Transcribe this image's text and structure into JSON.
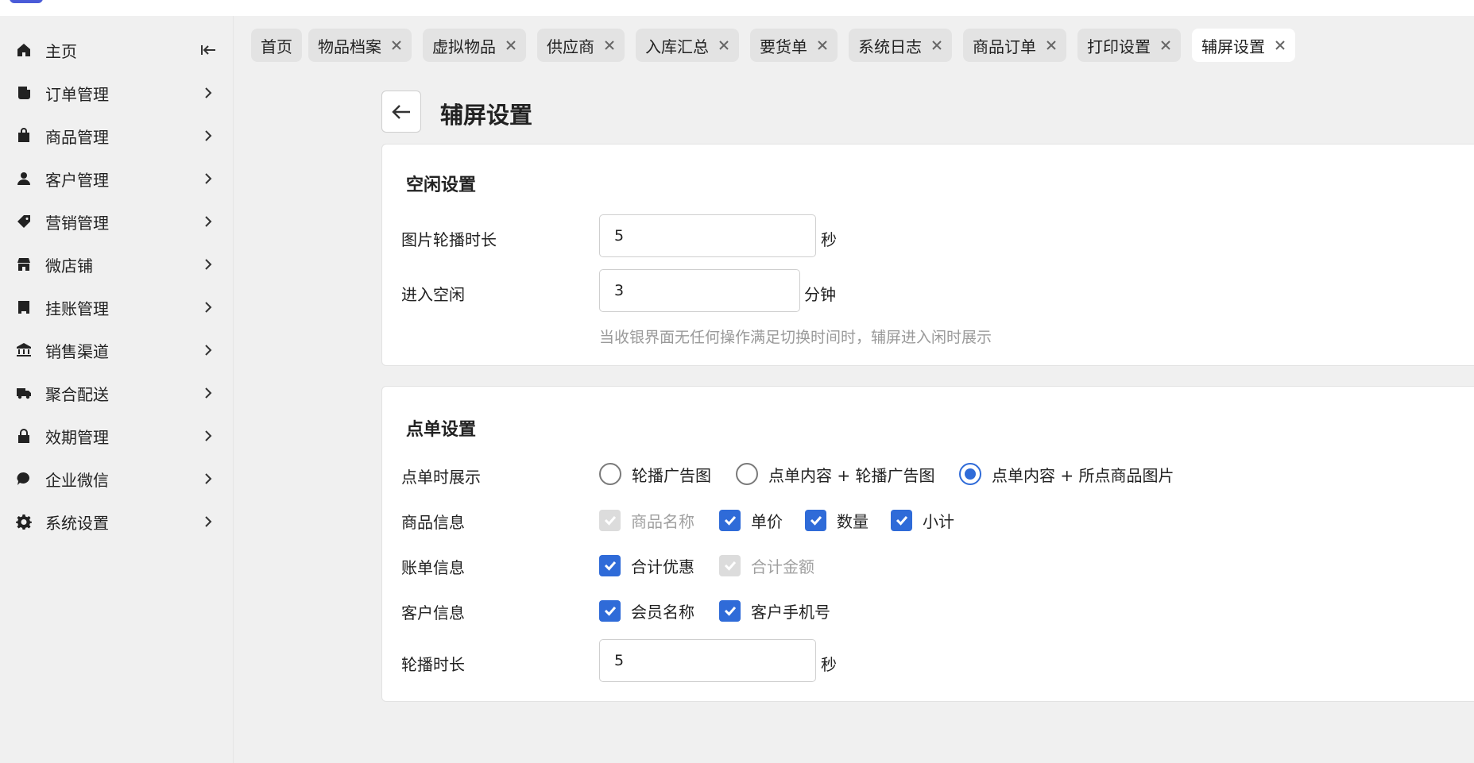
{
  "colors": {
    "accent": "#2f6bd8",
    "disabled": "#dcdcdc",
    "page_bg": "#f0f0f0"
  },
  "sidebar": {
    "items": [
      {
        "label": "主页",
        "icon": "home-icon"
      },
      {
        "label": "订单管理",
        "icon": "order-icon"
      },
      {
        "label": "商品管理",
        "icon": "product-icon"
      },
      {
        "label": "客户管理",
        "icon": "user-icon"
      },
      {
        "label": "营销管理",
        "icon": "tag-icon"
      },
      {
        "label": "微店铺",
        "icon": "shop-icon"
      },
      {
        "label": "挂账管理",
        "icon": "ledger-icon"
      },
      {
        "label": "销售渠道",
        "icon": "bank-icon"
      },
      {
        "label": "聚合配送",
        "icon": "truck-icon"
      },
      {
        "label": "效期管理",
        "icon": "lock-icon"
      },
      {
        "label": "企业微信",
        "icon": "chat-icon"
      },
      {
        "label": "系统设置",
        "icon": "gear-icon"
      }
    ]
  },
  "tabs": [
    {
      "label": "首页"
    },
    {
      "label": "物品档案"
    },
    {
      "label": "虚拟物品"
    },
    {
      "label": "供应商"
    },
    {
      "label": "入库汇总"
    },
    {
      "label": "要货单"
    },
    {
      "label": "系统日志"
    },
    {
      "label": "商品订单"
    },
    {
      "label": "打印设置"
    },
    {
      "label": "辅屏设置"
    }
  ],
  "page": {
    "title": "辅屏设置"
  },
  "idle": {
    "title": "空闲设置",
    "carousel": {
      "label": "图片轮播时长",
      "value": "5",
      "unit": "秒"
    },
    "enter_idle": {
      "label": "进入空闲",
      "value": "3",
      "unit": "分钟"
    },
    "hint": "当收银界面无任何操作满足切换时间时，辅屏进入闲时展示"
  },
  "order": {
    "title": "点单设置",
    "display": {
      "label": "点单时展示",
      "options": [
        {
          "label": "轮播广告图",
          "checked": false
        },
        {
          "label": "点单内容 + 轮播广告图",
          "checked": false
        },
        {
          "label": "点单内容 + 所点商品图片",
          "checked": true
        }
      ]
    },
    "goods_info": {
      "label": "商品信息",
      "options": [
        {
          "label": "商品名称",
          "checked": true,
          "disabled": true
        },
        {
          "label": "单价",
          "checked": true,
          "disabled": false
        },
        {
          "label": "数量",
          "checked": true,
          "disabled": false
        },
        {
          "label": "小计",
          "checked": true,
          "disabled": false
        }
      ]
    },
    "bill_info": {
      "label": "账单信息",
      "options": [
        {
          "label": "合计优惠",
          "checked": true,
          "disabled": false
        },
        {
          "label": "合计金额",
          "checked": true,
          "disabled": true
        }
      ]
    },
    "customer_info": {
      "label": "客户信息",
      "options": [
        {
          "label": "会员名称",
          "checked": true,
          "disabled": false
        },
        {
          "label": "客户手机号",
          "checked": true,
          "disabled": false
        }
      ]
    },
    "carousel": {
      "label": "轮播时长",
      "value": "5",
      "unit": "秒"
    }
  }
}
